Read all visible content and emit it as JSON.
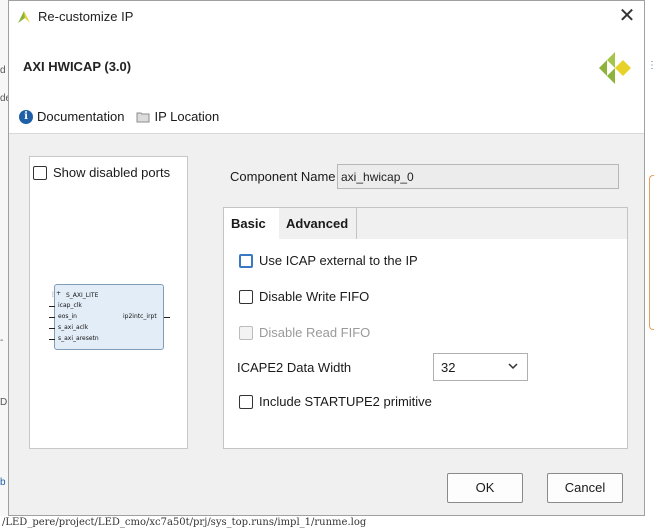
{
  "window": {
    "title": "Re-customize IP"
  },
  "header": {
    "ip_name": "AXI HWICAP (3.0)"
  },
  "links": {
    "documentation": "Documentation",
    "ip_location": "IP Location"
  },
  "symbol": {
    "show_disabled_ports": "Show disabled ports",
    "left_ports": [
      "S_AXI_LITE",
      "icap_clk",
      "eos_in",
      "s_axi_aclk",
      "s_axi_aresetn"
    ],
    "right_ports": [
      "ip2intc_irpt"
    ]
  },
  "component": {
    "label": "Component Name",
    "value": "axi_hwicap_0"
  },
  "tabs": [
    {
      "label": "Basic"
    },
    {
      "label": "Advanced"
    }
  ],
  "basic": {
    "use_icap_external": "Use ICAP external to the IP",
    "disable_write_fifo": "Disable Write FIFO",
    "disable_read_fifo": "Disable Read FIFO",
    "icape2_data_width_label": "ICAPE2 Data Width",
    "icape2_data_width_value": "32",
    "include_startupe2": "Include STARTUPE2 primitive"
  },
  "buttons": {
    "ok": "OK",
    "cancel": "Cancel"
  },
  "background": {
    "left_fragments": [
      "d",
      "de",
      "-",
      "D",
      "b",
      "/"
    ],
    "bottom_path": "/LED_pere/project/LED_cmo/xc7a50t/prj/sys_top.runs/impl_1/runme.log"
  },
  "colors": {
    "accent": "#3b78c4",
    "info_icon": "#1e5fa8",
    "ip_block_fill": "#e3edf7",
    "logo_green": "#8db33a",
    "logo_yellow": "#e8d22a"
  }
}
